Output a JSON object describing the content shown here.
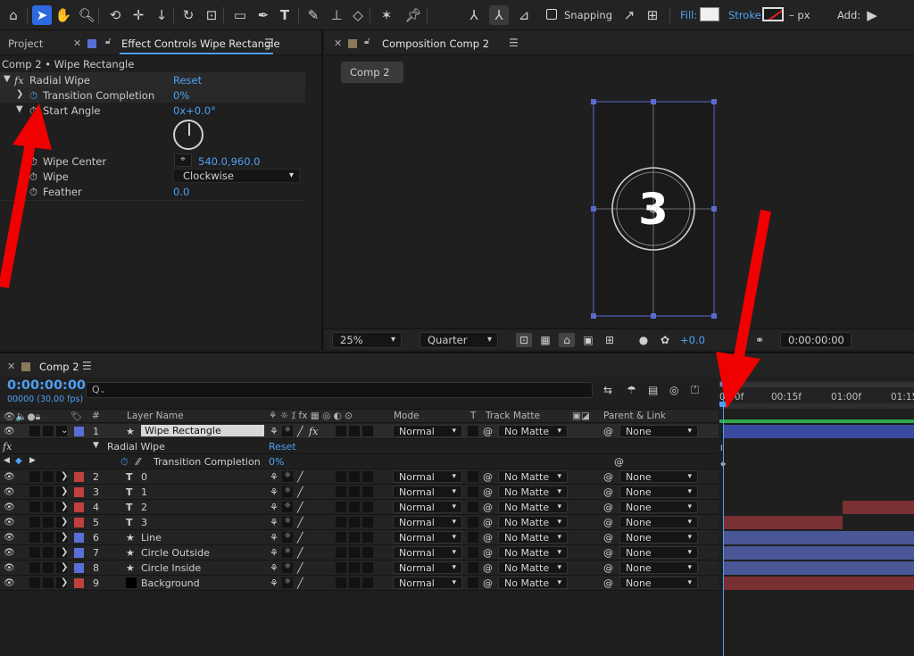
{
  "toolbar": {
    "snapping_label": "Snapping",
    "fill_label": "Fill:",
    "stroke_label": "Stroke:",
    "stroke_width": "– px",
    "add_label": "Add:"
  },
  "left_panel": {
    "tab_project": "Project",
    "tab_effect_controls": "Effect Controls Wipe Rectangle",
    "breadcrumb": "Comp 2 • Wipe Rectangle",
    "effect": {
      "fx_glyph": "fx",
      "name": "Radial Wipe",
      "reset": "Reset",
      "transition_label": "Transition Completion",
      "transition_value": "0%",
      "start_angle_label": "Start Angle",
      "start_angle_value": "0x+0.0°",
      "wipe_center_label": "Wipe Center",
      "wipe_center_value": "540.0,960.0",
      "wipe_label": "Wipe",
      "wipe_value": "Clockwise",
      "feather_label": "Feather",
      "feather_value": "0.0"
    }
  },
  "comp_panel": {
    "tab_label": "Composition Comp 2",
    "chip": "Comp 2",
    "number_text": "3",
    "zoom": "25%",
    "resolution": "Quarter",
    "exposure": "+0.0",
    "timecode": "0:00:00:00"
  },
  "timeline": {
    "tab_label": "Comp 2",
    "timecode": "0:00:00:00",
    "fps": "00000 (30.00 fps)",
    "search_placeholder": "Q",
    "headers": {
      "num": "#",
      "layer_name": "Layer Name",
      "mode": "Mode",
      "t": "T",
      "track_matte": "Track Matte",
      "parent": "Parent & Link"
    },
    "ruler": [
      "0:00f",
      "00:15f",
      "01:00f",
      "01:15"
    ],
    "sub_rows": {
      "effect_name": "Radial Wipe",
      "effect_reset": "Reset",
      "prop_name": "Transition Completion",
      "prop_value": "0%"
    },
    "layers": [
      {
        "num": "1",
        "type": "star",
        "name": "Wipe Rectangle",
        "mode": "Normal",
        "matte": "No Matte",
        "parent": "None",
        "color": "#5a6fd6"
      },
      {
        "num": "2",
        "type": "T",
        "name": "0",
        "mode": "Normal",
        "matte": "No Matte",
        "parent": "None",
        "color": "#c04040"
      },
      {
        "num": "3",
        "type": "T",
        "name": "1",
        "mode": "Normal",
        "matte": "No Matte",
        "parent": "None",
        "color": "#c04040"
      },
      {
        "num": "4",
        "type": "T",
        "name": "2",
        "mode": "Normal",
        "matte": "No Matte",
        "parent": "None",
        "color": "#c04040"
      },
      {
        "num": "5",
        "type": "T",
        "name": "3",
        "mode": "Normal",
        "matte": "No Matte",
        "parent": "None",
        "color": "#c04040"
      },
      {
        "num": "6",
        "type": "star",
        "name": "Line",
        "mode": "Normal",
        "matte": "No Matte",
        "parent": "None",
        "color": "#5a6fd6"
      },
      {
        "num": "7",
        "type": "star",
        "name": "Circle Outside",
        "mode": "Normal",
        "matte": "No Matte",
        "parent": "None",
        "color": "#5a6fd6"
      },
      {
        "num": "8",
        "type": "star",
        "name": "Circle Inside",
        "mode": "Normal",
        "matte": "No Matte",
        "parent": "None",
        "color": "#5a6fd6"
      },
      {
        "num": "9",
        "type": "solid",
        "name": "Background",
        "mode": "Normal",
        "matte": "No Matte",
        "parent": "None",
        "color": "#c04040"
      }
    ]
  },
  "colors": {
    "accent_blue": "#4ea0f5",
    "annotation_red": "#f00000",
    "bar_blue": "#4a5797",
    "bar_red": "#7a2f33"
  }
}
